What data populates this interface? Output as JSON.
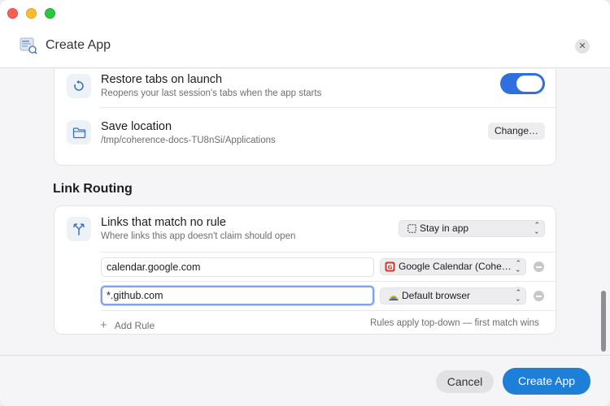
{
  "window": {
    "title": "Create App"
  },
  "settings": {
    "restore": {
      "title": "Restore tabs on launch",
      "subtitle": "Reopens your last session's tabs when the app starts",
      "enabled": true
    },
    "save_location": {
      "title": "Save location",
      "path": "/tmp/coherence-docs-TU8nSi/Applications",
      "button": "Change…"
    }
  },
  "link_routing": {
    "section_title": "Link Routing",
    "fallback": {
      "title": "Links that match no rule",
      "subtitle": "Where links this app doesn't claim should open",
      "value": "Stay in app"
    },
    "rules": [
      {
        "pattern": "calendar.google.com",
        "target": "Google Calendar (Cohe…",
        "target_icon": "google-calendar-icon"
      },
      {
        "pattern": "*.github.com",
        "target": "Default browser",
        "target_icon": "browser-icon"
      }
    ],
    "add_rule": "Add Rule",
    "footnote": "Rules apply top-down — first match wins"
  },
  "footer": {
    "cancel": "Cancel",
    "create": "Create App"
  },
  "colors": {
    "accent": "#2f6fe0",
    "primary_button": "#1e7fd8"
  }
}
